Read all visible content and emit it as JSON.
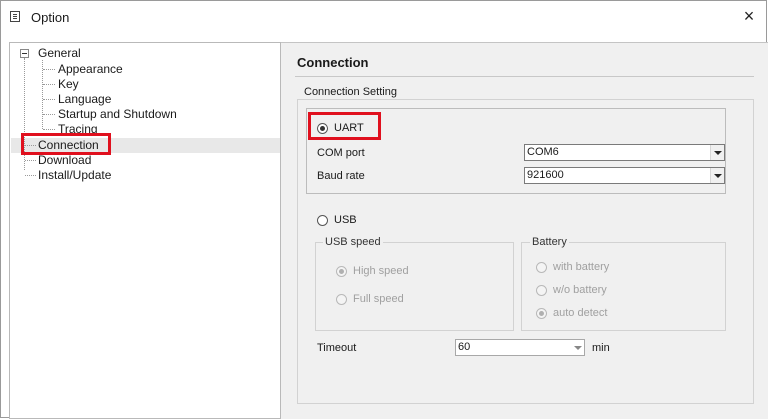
{
  "window": {
    "title": "Option",
    "close_icon": "×"
  },
  "tree": {
    "root": "General",
    "children": [
      "Appearance",
      "Key",
      "Language",
      "Startup and Shutdown",
      "Tracing"
    ],
    "siblings": [
      "Connection",
      "Download",
      "Install/Update"
    ],
    "selected": "Connection"
  },
  "page": {
    "title": "Connection",
    "connection_setting": {
      "legend": "Connection Setting",
      "uart_label": "UART",
      "uart_selected": true,
      "com_port_label": "COM port",
      "com_port_value": "COM6",
      "baud_rate_label": "Baud rate",
      "baud_rate_value": "921600"
    },
    "usb": {
      "label": "USB",
      "selected": false,
      "speed": {
        "legend": "USB speed",
        "options": [
          "High speed",
          "Full speed"
        ],
        "selected": "High speed"
      },
      "battery": {
        "legend": "Battery",
        "options": [
          "with battery",
          "w/o battery",
          "auto detect"
        ],
        "selected": "auto detect"
      }
    },
    "timeout": {
      "label": "Timeout",
      "value": "60",
      "unit": "min"
    }
  },
  "colors": {
    "highlight_box": "#e0101e",
    "panel_bg": "#f0f0f0"
  }
}
